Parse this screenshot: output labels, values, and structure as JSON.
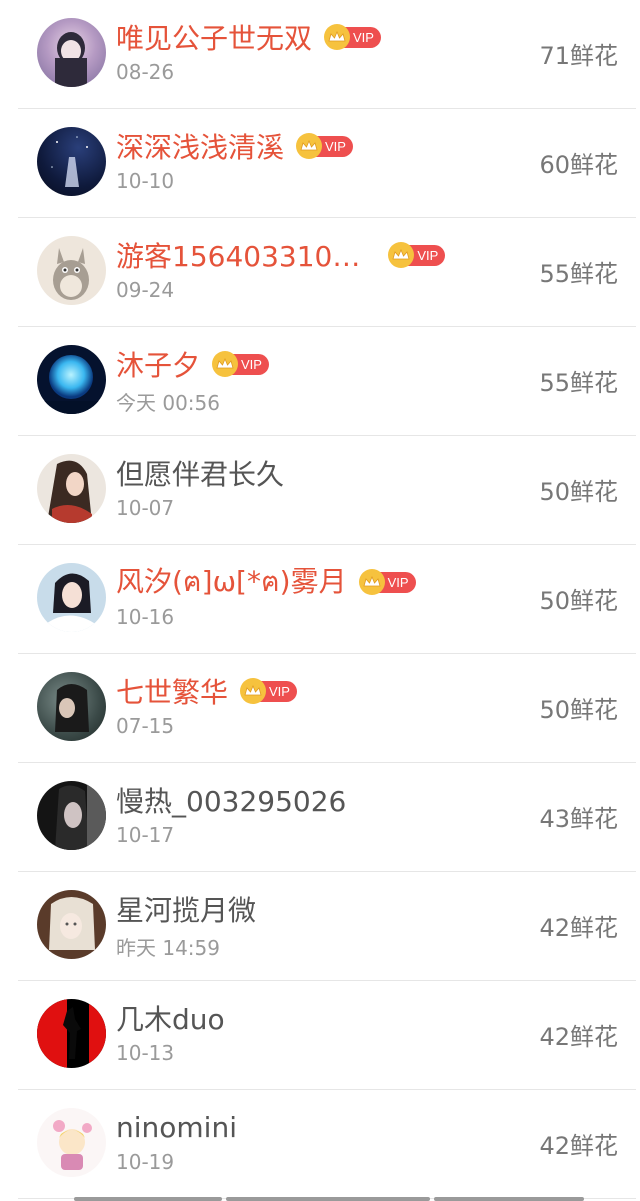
{
  "vip_label": "VIP",
  "colors": {
    "vip_name": "#e5533a",
    "normal_name": "#555555",
    "vip_badge": "#ee4f4f",
    "crown": "#f6c23e"
  },
  "rows": [
    {
      "name": "唯见公子世无双",
      "vip": true,
      "date": "08-26",
      "flowers": "71鲜花",
      "avatar_icon": "avatar-icon"
    },
    {
      "name": "深深浅浅清溪",
      "vip": true,
      "date": "10-10",
      "flowers": "60鲜花",
      "avatar_icon": "avatar-icon"
    },
    {
      "name": "游客156403310…",
      "vip": true,
      "date": "09-24",
      "flowers": "55鲜花",
      "avatar_icon": "avatar-icon"
    },
    {
      "name": "沐子夕",
      "vip": true,
      "date": "今天 00:56",
      "flowers": "55鲜花",
      "avatar_icon": "avatar-icon"
    },
    {
      "name": "但愿伴君长久",
      "vip": false,
      "date": "10-07",
      "flowers": "50鲜花",
      "avatar_icon": "avatar-icon"
    },
    {
      "name": "风汐(ฅ]ω[*ฅ)雾月",
      "vip": true,
      "date": "10-16",
      "flowers": "50鲜花",
      "avatar_icon": "avatar-icon"
    },
    {
      "name": "七世繁华",
      "vip": true,
      "date": "07-15",
      "flowers": "50鲜花",
      "avatar_icon": "avatar-icon"
    },
    {
      "name": "慢热_003295026",
      "vip": false,
      "date": "10-17",
      "flowers": "43鲜花",
      "avatar_icon": "avatar-icon"
    },
    {
      "name": "星河揽月微",
      "vip": false,
      "date": "昨天 14:59",
      "flowers": "42鲜花",
      "avatar_icon": "avatar-icon"
    },
    {
      "name": "几木duo",
      "vip": false,
      "date": "10-13",
      "flowers": "42鲜花",
      "avatar_icon": "avatar-icon"
    },
    {
      "name": "ninomini",
      "vip": false,
      "date": "10-19",
      "flowers": "42鲜花",
      "avatar_icon": "avatar-icon"
    }
  ]
}
